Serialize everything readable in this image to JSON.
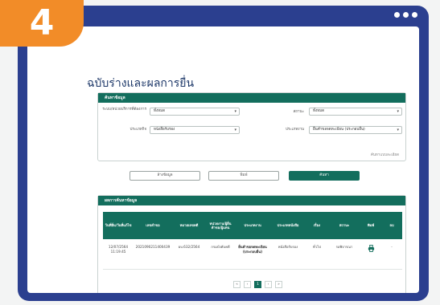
{
  "step_number": "4",
  "page_title": "ฉบับร่างและผลการยื่น",
  "search_panel": {
    "title": "ค้นหาข้อมูล",
    "fields": [
      {
        "label": "ระบบ/หน่วยบริการที่ต้องการ",
        "value": "ทั้งหมด"
      },
      {
        "label": "สถานะ",
        "value": "ทั้งหมด"
      },
      {
        "label": "ประเภทกิจ",
        "value": "หนังสือรับรอง"
      },
      {
        "label": "ประเภทงาน",
        "value": "ยื่นคำขอจดทะเบียน (ประกอบอื่น)"
      }
    ],
    "advanced_link": "ค้นหาแบบละเอียด"
  },
  "buttons": {
    "clear": "ล้างข้อมูล",
    "print": "พิมพ์",
    "search": "ค้นหา"
  },
  "results_panel": {
    "title": "ผลการค้นหาข้อมูล",
    "columns": [
      "วันที่ยื่น/วันที่แก้ไข",
      "เลขคำขอ",
      "หมายเลขคดี",
      "หน่วยงาน/ผู้ยื่นคำขอ/ผู้แทน",
      "ประเภทงาน",
      "ประเภทหนังสือ",
      "เรื่อง",
      "สถานะ",
      "พิมพ์",
      "ลบ"
    ],
    "rows": [
      {
        "date": "12/07/2564 11:19:45",
        "request_no": "2021090211400439",
        "case_no": "ผบ.632/2564",
        "agency": "กรมบังคับคดี",
        "work_type": "ยื่นคำขอจดทะเบียน (ประกอบอื่น)",
        "doc_type": "หนังสือรับรอง",
        "subject": "ทั่วไป",
        "status": "รอพิจารณา",
        "delete": "-"
      }
    ]
  },
  "pagination": {
    "pages": [
      "«",
      "‹",
      "1",
      "›",
      "»"
    ],
    "current": "1"
  },
  "colors": {
    "frame": "#2b3f8f",
    "accent": "#136e5d",
    "badge": "#f28c28"
  }
}
